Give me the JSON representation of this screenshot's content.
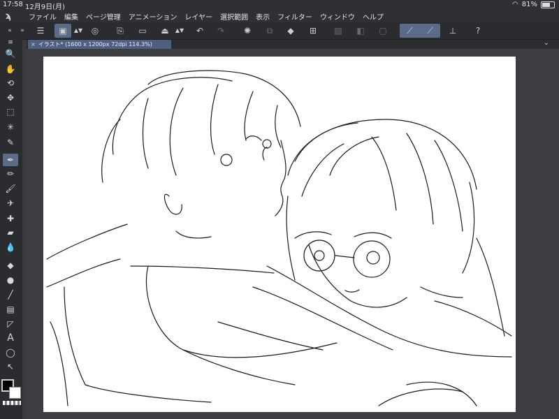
{
  "status": {
    "time": "17:58",
    "date": "12月9日(月)",
    "battery": "81%",
    "battery_level": 0.81
  },
  "menu": [
    "ファイル",
    "編集",
    "ページ管理",
    "アニメーション",
    "レイヤー",
    "選択範囲",
    "表示",
    "フィルター",
    "ウィンドウ",
    "ヘルプ"
  ],
  "tab": {
    "title": "イラスト* (1600 x 1200px 72dpi 114.3%)"
  },
  "icons": {
    "menu": "☰",
    "canvas_new": "▣",
    "spiral": "◎",
    "new_file": "⎘",
    "open_folder": "▭",
    "save": "⏏",
    "undo": "↶",
    "redo": "↷",
    "loading": "✺",
    "fill": "◆",
    "transform": "⊞",
    "select_off": "▨",
    "tone": "◧",
    "frame": "▢",
    "snap1": "⟋",
    "snap2": "⟋",
    "ruler": "⊥",
    "help": "?"
  },
  "tools": [
    {
      "name": "zoom",
      "glyph": "🔍"
    },
    {
      "name": "hand",
      "glyph": "✋"
    },
    {
      "name": "rotate",
      "glyph": "⟲"
    },
    {
      "name": "move",
      "glyph": "✥"
    },
    {
      "name": "marquee",
      "glyph": "⬚"
    },
    {
      "name": "magic-wand",
      "glyph": "✳"
    },
    {
      "name": "eyedropper",
      "glyph": "✎"
    },
    {
      "name": "pen",
      "glyph": "✒"
    },
    {
      "name": "pencil",
      "glyph": "✏"
    },
    {
      "name": "brush",
      "glyph": "🖌"
    },
    {
      "name": "airbrush",
      "glyph": "✈"
    },
    {
      "name": "decoration",
      "glyph": "✚"
    },
    {
      "name": "eraser",
      "glyph": "▰"
    },
    {
      "name": "blend",
      "glyph": "💧"
    },
    {
      "name": "fill",
      "glyph": "◆"
    },
    {
      "name": "gradient",
      "glyph": "●"
    },
    {
      "name": "figure",
      "glyph": "╱"
    },
    {
      "name": "frame-border",
      "glyph": "▤"
    },
    {
      "name": "ruler",
      "glyph": "◸"
    },
    {
      "name": "text",
      "glyph": "A"
    },
    {
      "name": "balloon",
      "glyph": "◯"
    },
    {
      "name": "correct-line",
      "glyph": "↖"
    }
  ]
}
